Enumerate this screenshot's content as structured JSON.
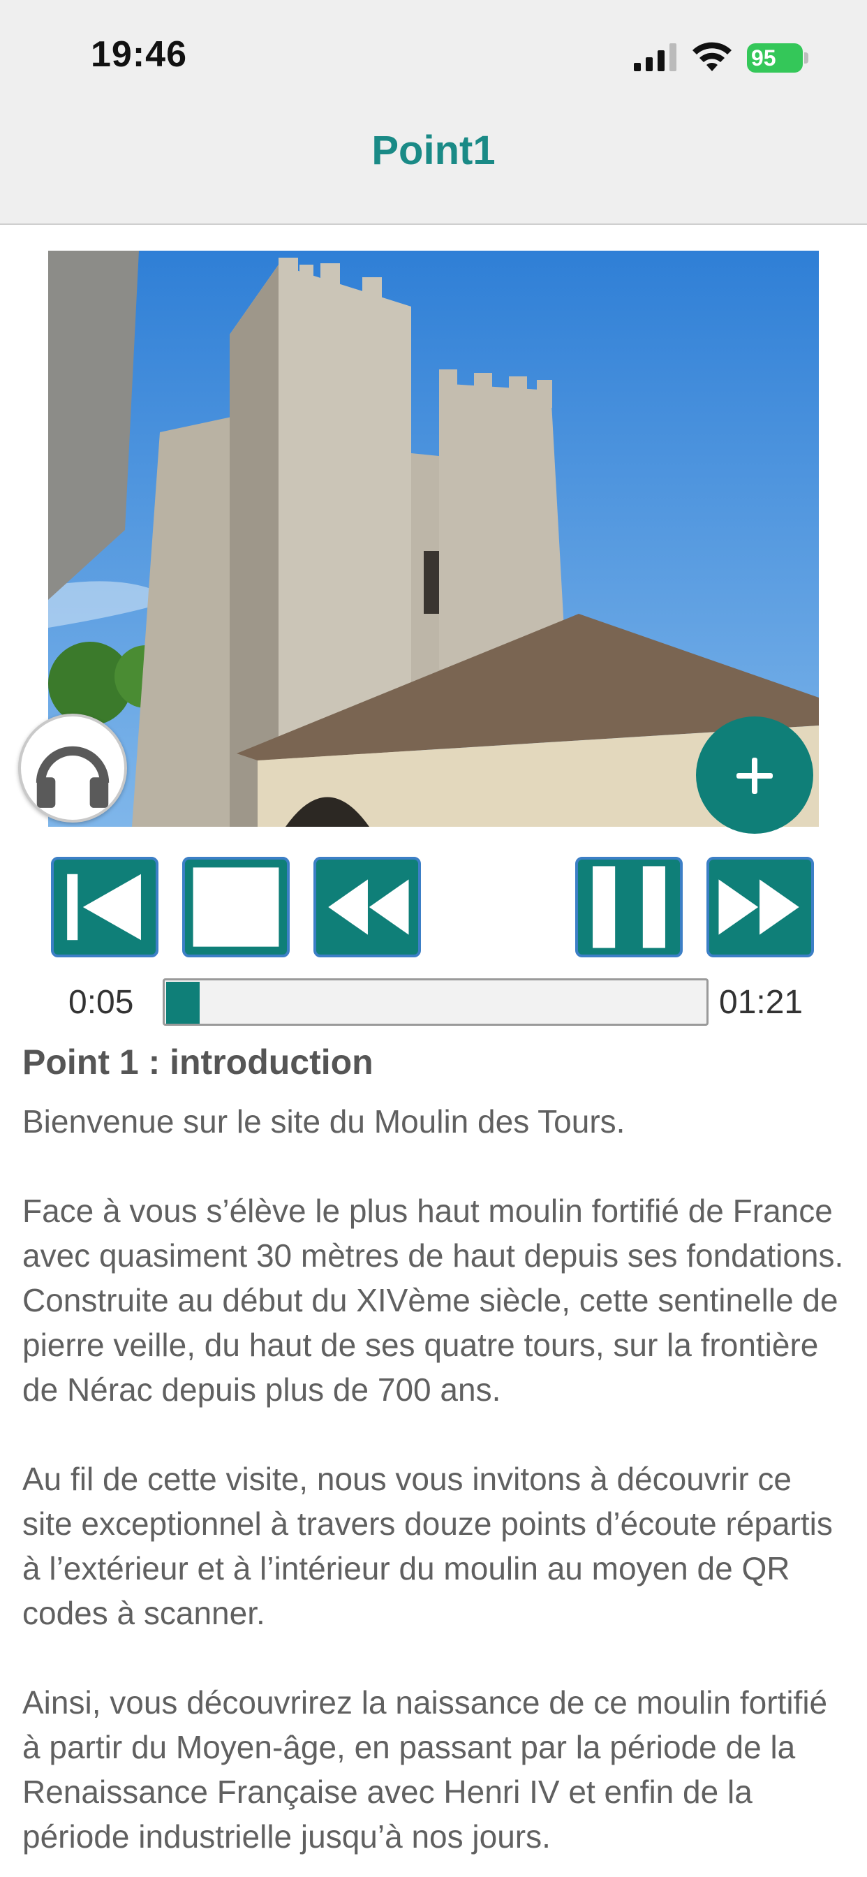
{
  "status_bar": {
    "time": "19:46",
    "battery": "95"
  },
  "nav": {
    "title": "Point1"
  },
  "player": {
    "current_time": "0:05",
    "total_time": "01:21",
    "progress": 0.062
  },
  "content": {
    "title": "Point 1 : introduction",
    "paragraphs": [
      "Bienvenue sur le site du Moulin des Tours.",
      "Face à vous s’élève le plus haut moulin fortifié de France avec quasiment 30 mètres de haut depuis ses fondations. Construite au début du XIVème siècle, cette sentinelle de pierre veille, du haut de ses quatre tours, sur la frontière de Nérac depuis plus de 700 ans.",
      "Au fil de cette visite, nous vous invitons à découvrir ce site exceptionnel à travers douze points d’écoute répartis à l’extérieur et à l’intérieur du moulin au moyen de QR codes à scanner.",
      "Ainsi, vous découvrirez la naissance de ce moulin fortifié à partir du Moyen-âge, en passant par la période de la Renaissance Française avec Henri IV et enfin de la période industrielle jusqu’à nos jours."
    ]
  },
  "colors": {
    "accent": "#0f7f78",
    "title": "#1a8a86",
    "control_border": "#3c7fc6"
  }
}
